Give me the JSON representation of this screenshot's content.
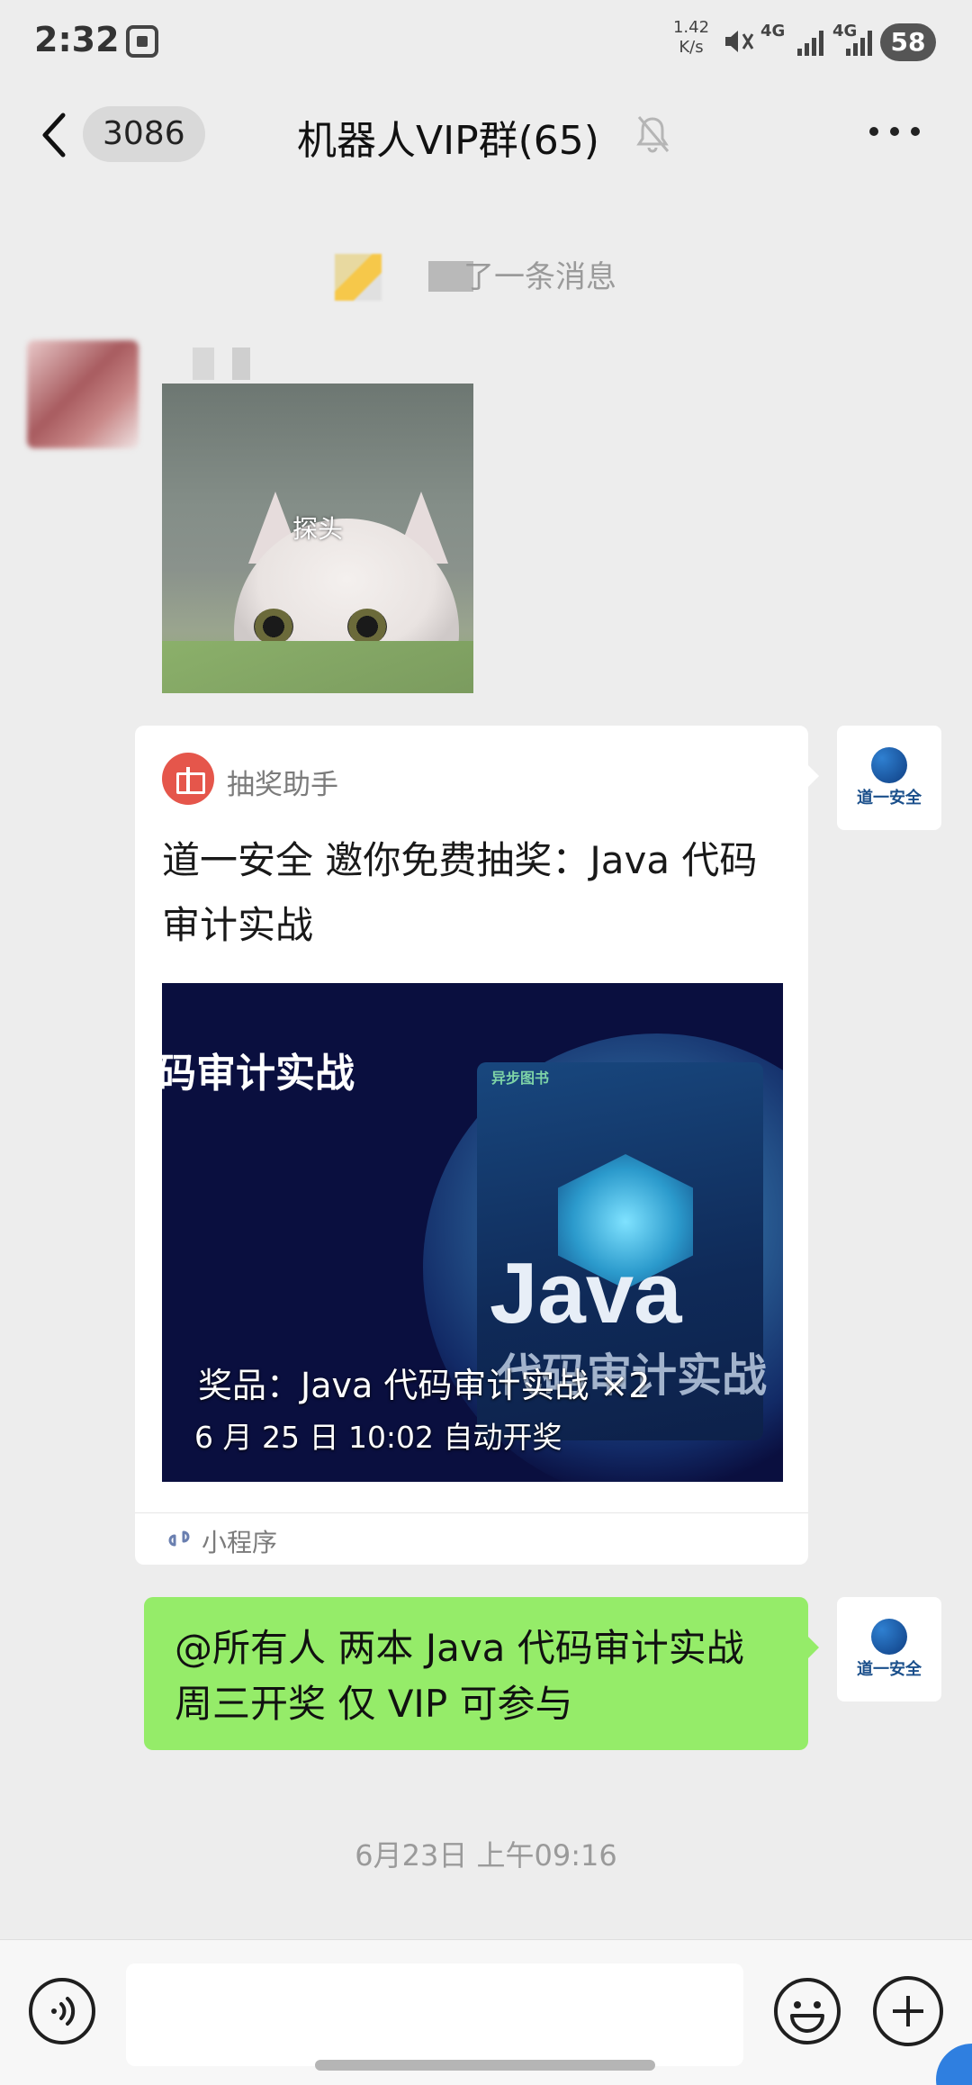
{
  "status_bar": {
    "time": "2:32",
    "net_speed_value": "1.42",
    "net_speed_unit": "K/s",
    "network_1": "4G",
    "network_2": "4G",
    "battery": "58"
  },
  "header": {
    "unread_count": "3086",
    "title": "机器人VIP群(65)"
  },
  "system_message": {
    "text": "了一条消息"
  },
  "sticker": {
    "caption": "探头"
  },
  "mini_program_card": {
    "app_name": "抽奖助手",
    "title": "道一安全 邀你免费抽奖：Java 代码审计实战",
    "image_headline": "码审计实战",
    "book_title_en": "Java",
    "book_title_cn": "代码审计实战",
    "book_brand": "异步图书",
    "prize": "奖品：Java 代码审计实战 ×2",
    "draw_time": "6 月 25 日 10:02 自动开奖",
    "footer_label": "小程序"
  },
  "avatar_right": {
    "org_name": "道一安全"
  },
  "green_message": {
    "text": "@所有人  两本 Java 代码审计实战  周三开奖  仅 VIP 可参与"
  },
  "timestamp": "6月23日 上午09:16",
  "icons": [
    "screenshot-icon",
    "mute-icon",
    "signal-icon",
    "back-arrow-icon",
    "bell-off-icon",
    "more-icon",
    "gift-icon",
    "mini-program-icon",
    "voice-icon",
    "emoji-icon",
    "plus-icon"
  ]
}
